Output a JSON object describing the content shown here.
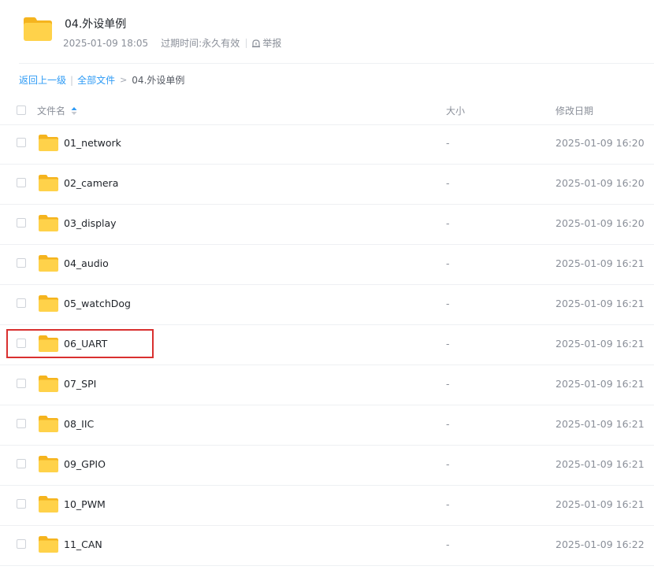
{
  "header": {
    "title": "04.外设单例",
    "date": "2025-01-09 18:05",
    "expire_label": "过期时间:",
    "expire_value": "永久有效",
    "report_label": "举报",
    "folder_icon": "folder-icon"
  },
  "breadcrumb": {
    "back": "返回上一级",
    "all_files": "全部文件",
    "separator": "|",
    "arrow": ">",
    "current": "04.外设单例"
  },
  "table": {
    "columns": {
      "name": "文件名",
      "size": "大小",
      "date": "修改日期"
    },
    "rows": [
      {
        "name": "01_network",
        "size": "-",
        "date": "2025-01-09 16:20"
      },
      {
        "name": "02_camera",
        "size": "-",
        "date": "2025-01-09 16:20"
      },
      {
        "name": "03_display",
        "size": "-",
        "date": "2025-01-09 16:20"
      },
      {
        "name": "04_audio",
        "size": "-",
        "date": "2025-01-09 16:21"
      },
      {
        "name": "05_watchDog",
        "size": "-",
        "date": "2025-01-09 16:21"
      },
      {
        "name": "06_UART",
        "size": "-",
        "date": "2025-01-09 16:21"
      },
      {
        "name": "07_SPI",
        "size": "-",
        "date": "2025-01-09 16:21"
      },
      {
        "name": "08_IIC",
        "size": "-",
        "date": "2025-01-09 16:21"
      },
      {
        "name": "09_GPIO",
        "size": "-",
        "date": "2025-01-09 16:21"
      },
      {
        "name": "10_PWM",
        "size": "-",
        "date": "2025-01-09 16:21"
      },
      {
        "name": "11_CAN",
        "size": "-",
        "date": "2025-01-09 16:22"
      }
    ]
  },
  "colors": {
    "link": "#2e9bf5",
    "folder_front": "#ffd24a",
    "folder_back": "#f5b41e",
    "highlight": "#d9302f",
    "muted_text": "#8a8f99"
  }
}
